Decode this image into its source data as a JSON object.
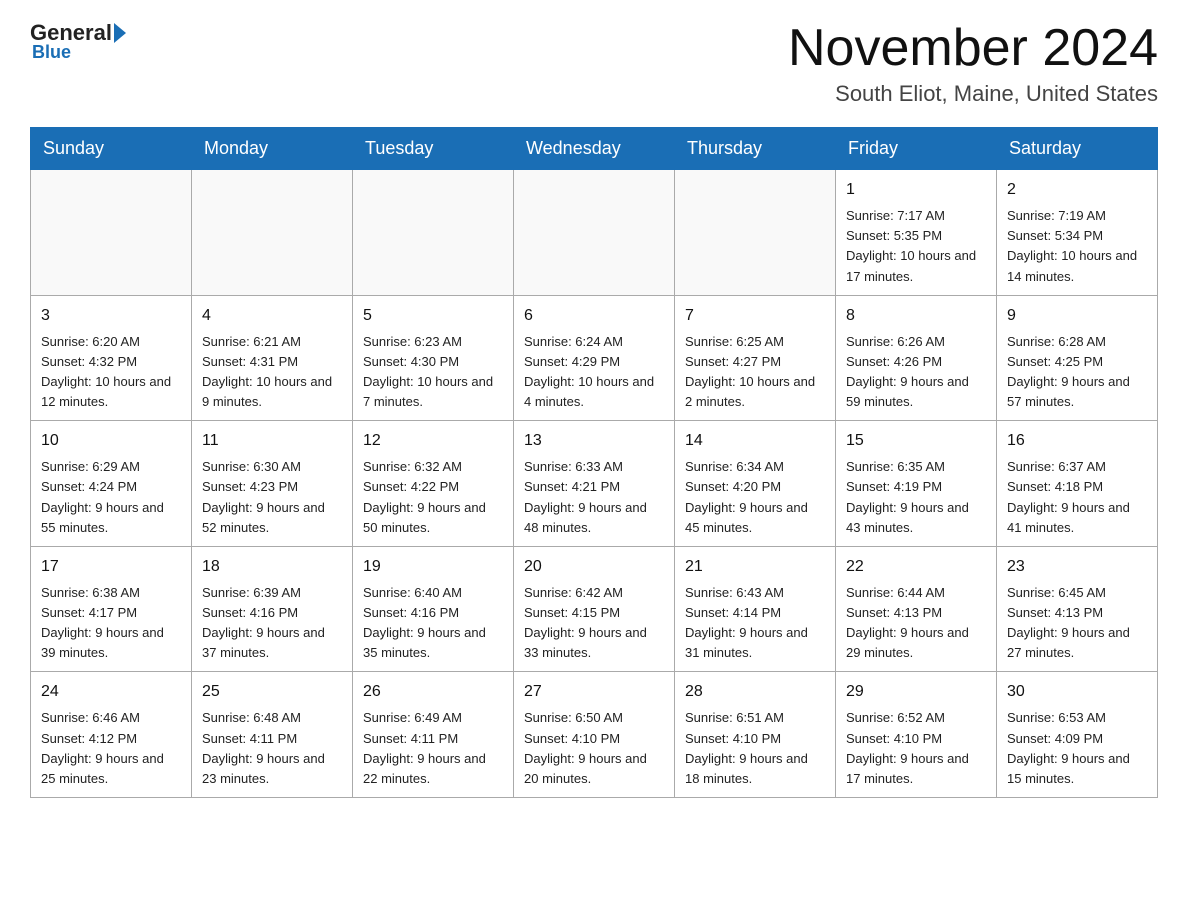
{
  "header": {
    "logo_general": "General",
    "logo_blue": "Blue",
    "month_title": "November 2024",
    "location": "South Eliot, Maine, United States"
  },
  "weekdays": [
    "Sunday",
    "Monday",
    "Tuesday",
    "Wednesday",
    "Thursday",
    "Friday",
    "Saturday"
  ],
  "weeks": [
    [
      {
        "day": "",
        "info": ""
      },
      {
        "day": "",
        "info": ""
      },
      {
        "day": "",
        "info": ""
      },
      {
        "day": "",
        "info": ""
      },
      {
        "day": "",
        "info": ""
      },
      {
        "day": "1",
        "info": "Sunrise: 7:17 AM\nSunset: 5:35 PM\nDaylight: 10 hours and 17 minutes."
      },
      {
        "day": "2",
        "info": "Sunrise: 7:19 AM\nSunset: 5:34 PM\nDaylight: 10 hours and 14 minutes."
      }
    ],
    [
      {
        "day": "3",
        "info": "Sunrise: 6:20 AM\nSunset: 4:32 PM\nDaylight: 10 hours and 12 minutes."
      },
      {
        "day": "4",
        "info": "Sunrise: 6:21 AM\nSunset: 4:31 PM\nDaylight: 10 hours and 9 minutes."
      },
      {
        "day": "5",
        "info": "Sunrise: 6:23 AM\nSunset: 4:30 PM\nDaylight: 10 hours and 7 minutes."
      },
      {
        "day": "6",
        "info": "Sunrise: 6:24 AM\nSunset: 4:29 PM\nDaylight: 10 hours and 4 minutes."
      },
      {
        "day": "7",
        "info": "Sunrise: 6:25 AM\nSunset: 4:27 PM\nDaylight: 10 hours and 2 minutes."
      },
      {
        "day": "8",
        "info": "Sunrise: 6:26 AM\nSunset: 4:26 PM\nDaylight: 9 hours and 59 minutes."
      },
      {
        "day": "9",
        "info": "Sunrise: 6:28 AM\nSunset: 4:25 PM\nDaylight: 9 hours and 57 minutes."
      }
    ],
    [
      {
        "day": "10",
        "info": "Sunrise: 6:29 AM\nSunset: 4:24 PM\nDaylight: 9 hours and 55 minutes."
      },
      {
        "day": "11",
        "info": "Sunrise: 6:30 AM\nSunset: 4:23 PM\nDaylight: 9 hours and 52 minutes."
      },
      {
        "day": "12",
        "info": "Sunrise: 6:32 AM\nSunset: 4:22 PM\nDaylight: 9 hours and 50 minutes."
      },
      {
        "day": "13",
        "info": "Sunrise: 6:33 AM\nSunset: 4:21 PM\nDaylight: 9 hours and 48 minutes."
      },
      {
        "day": "14",
        "info": "Sunrise: 6:34 AM\nSunset: 4:20 PM\nDaylight: 9 hours and 45 minutes."
      },
      {
        "day": "15",
        "info": "Sunrise: 6:35 AM\nSunset: 4:19 PM\nDaylight: 9 hours and 43 minutes."
      },
      {
        "day": "16",
        "info": "Sunrise: 6:37 AM\nSunset: 4:18 PM\nDaylight: 9 hours and 41 minutes."
      }
    ],
    [
      {
        "day": "17",
        "info": "Sunrise: 6:38 AM\nSunset: 4:17 PM\nDaylight: 9 hours and 39 minutes."
      },
      {
        "day": "18",
        "info": "Sunrise: 6:39 AM\nSunset: 4:16 PM\nDaylight: 9 hours and 37 minutes."
      },
      {
        "day": "19",
        "info": "Sunrise: 6:40 AM\nSunset: 4:16 PM\nDaylight: 9 hours and 35 minutes."
      },
      {
        "day": "20",
        "info": "Sunrise: 6:42 AM\nSunset: 4:15 PM\nDaylight: 9 hours and 33 minutes."
      },
      {
        "day": "21",
        "info": "Sunrise: 6:43 AM\nSunset: 4:14 PM\nDaylight: 9 hours and 31 minutes."
      },
      {
        "day": "22",
        "info": "Sunrise: 6:44 AM\nSunset: 4:13 PM\nDaylight: 9 hours and 29 minutes."
      },
      {
        "day": "23",
        "info": "Sunrise: 6:45 AM\nSunset: 4:13 PM\nDaylight: 9 hours and 27 minutes."
      }
    ],
    [
      {
        "day": "24",
        "info": "Sunrise: 6:46 AM\nSunset: 4:12 PM\nDaylight: 9 hours and 25 minutes."
      },
      {
        "day": "25",
        "info": "Sunrise: 6:48 AM\nSunset: 4:11 PM\nDaylight: 9 hours and 23 minutes."
      },
      {
        "day": "26",
        "info": "Sunrise: 6:49 AM\nSunset: 4:11 PM\nDaylight: 9 hours and 22 minutes."
      },
      {
        "day": "27",
        "info": "Sunrise: 6:50 AM\nSunset: 4:10 PM\nDaylight: 9 hours and 20 minutes."
      },
      {
        "day": "28",
        "info": "Sunrise: 6:51 AM\nSunset: 4:10 PM\nDaylight: 9 hours and 18 minutes."
      },
      {
        "day": "29",
        "info": "Sunrise: 6:52 AM\nSunset: 4:10 PM\nDaylight: 9 hours and 17 minutes."
      },
      {
        "day": "30",
        "info": "Sunrise: 6:53 AM\nSunset: 4:09 PM\nDaylight: 9 hours and 15 minutes."
      }
    ]
  ]
}
